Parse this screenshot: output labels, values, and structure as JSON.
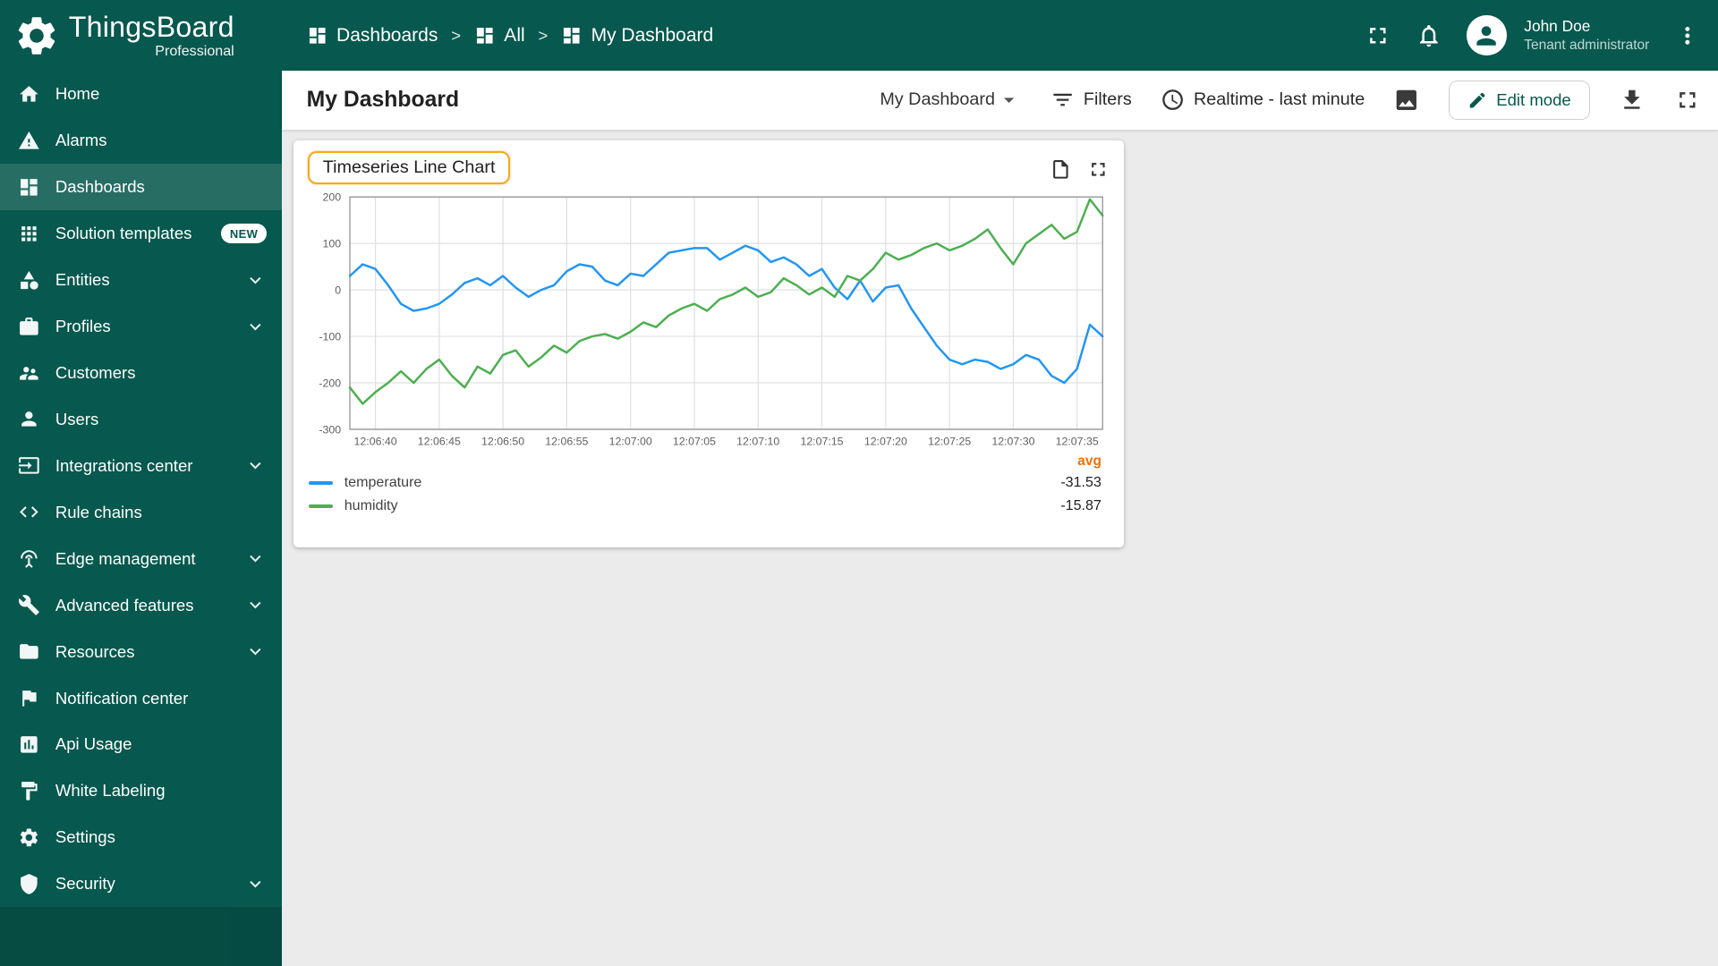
{
  "app": {
    "brand": "ThingsBoard",
    "brand_sub": "Professional"
  },
  "header": {
    "breadcrumb": [
      {
        "label": "Dashboards"
      },
      {
        "label": "All"
      },
      {
        "label": "My Dashboard"
      }
    ],
    "breadcrumb_separator": ">",
    "user": {
      "name": "John Doe",
      "role": "Tenant administrator"
    }
  },
  "sidebar": {
    "items": [
      {
        "label": "Home"
      },
      {
        "label": "Alarms"
      },
      {
        "label": "Dashboards",
        "active": true
      },
      {
        "label": "Solution templates",
        "badge": "NEW"
      },
      {
        "label": "Entities",
        "expandable": true
      },
      {
        "label": "Profiles",
        "expandable": true
      },
      {
        "label": "Customers"
      },
      {
        "label": "Users"
      },
      {
        "label": "Integrations center",
        "expandable": true
      },
      {
        "label": "Rule chains"
      },
      {
        "label": "Edge management",
        "expandable": true
      },
      {
        "label": "Advanced features",
        "expandable": true
      },
      {
        "label": "Resources",
        "expandable": true
      },
      {
        "label": "Notification center"
      },
      {
        "label": "Api Usage"
      },
      {
        "label": "White Labeling"
      },
      {
        "label": "Settings"
      },
      {
        "label": "Security",
        "expandable": true
      }
    ]
  },
  "toolbar": {
    "title": "My Dashboard",
    "dashboard_select": "My Dashboard",
    "filters_label": "Filters",
    "timewindow_label": "Realtime - last minute",
    "edit_button": "Edit mode"
  },
  "widget": {
    "title": "Timeseries Line Chart"
  },
  "chart_data": {
    "type": "line",
    "title": "Timeseries Line Chart",
    "ylim": [
      -300,
      200
    ],
    "y_ticks": [
      200,
      100,
      0,
      -100,
      -200,
      -300
    ],
    "x_ticks": [
      "12:06:40",
      "12:06:45",
      "12:06:50",
      "12:06:55",
      "12:07:00",
      "12:07:05",
      "12:07:10",
      "12:07:15",
      "12:07:20",
      "12:07:25",
      "12:07:30",
      "12:07:35"
    ],
    "x_tick_start_index": 2,
    "x_tick_step": 5,
    "grid": true,
    "legend_header": "avg",
    "legend_position": "bottom",
    "series": [
      {
        "name": "temperature",
        "color": "#2196f3",
        "avg": "-31.53",
        "values": [
          30,
          55,
          45,
          10,
          -30,
          -45,
          -40,
          -30,
          -10,
          15,
          25,
          10,
          30,
          5,
          -15,
          0,
          10,
          40,
          55,
          50,
          20,
          10,
          35,
          30,
          55,
          80,
          85,
          90,
          90,
          65,
          80,
          95,
          85,
          60,
          70,
          55,
          30,
          45,
          5,
          -20,
          20,
          -25,
          5,
          10,
          -40,
          -80,
          -120,
          -150,
          -160,
          -150,
          -155,
          -170,
          -160,
          -140,
          -150,
          -185,
          -200,
          -170,
          -75,
          -100
        ]
      },
      {
        "name": "humidity",
        "color": "#4caf50",
        "avg": "-15.87",
        "values": [
          -210,
          -245,
          -220,
          -200,
          -175,
          -200,
          -170,
          -150,
          -185,
          -210,
          -165,
          -180,
          -140,
          -130,
          -165,
          -145,
          -120,
          -135,
          -110,
          -100,
          -95,
          -105,
          -90,
          -70,
          -80,
          -55,
          -40,
          -30,
          -45,
          -20,
          -10,
          5,
          -15,
          -5,
          25,
          10,
          -10,
          5,
          -15,
          30,
          20,
          45,
          80,
          65,
          75,
          90,
          100,
          85,
          95,
          110,
          130,
          90,
          55,
          100,
          120,
          140,
          110,
          125,
          195,
          160
        ]
      }
    ]
  }
}
